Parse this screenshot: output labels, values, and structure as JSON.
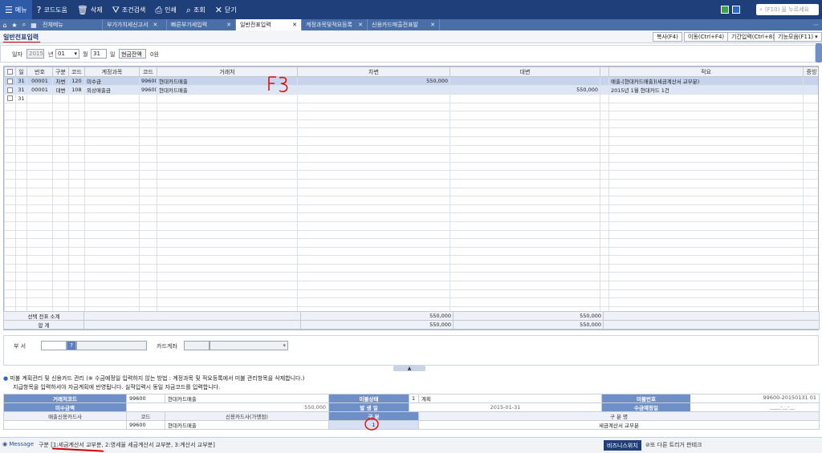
{
  "toolbar": {
    "items": [
      {
        "icon": "hamburger-icon",
        "glyph": "☰",
        "label": "메뉴"
      },
      {
        "icon": "help-icon",
        "glyph": "?",
        "label": "코드도움"
      },
      {
        "icon": "trash-icon",
        "glyph": "🗑",
        "label": "삭제"
      },
      {
        "icon": "filter-icon",
        "glyph": "⛛",
        "label": "조건검색"
      },
      {
        "icon": "print-icon",
        "glyph": "⎙",
        "label": "인쇄"
      },
      {
        "icon": "search-icon",
        "glyph": "⌕",
        "label": "조회"
      },
      {
        "icon": "close-icon",
        "glyph": "✕",
        "label": "닫기"
      }
    ],
    "search_placeholder": "(F10) 을 누르세요"
  },
  "tabs": [
    {
      "label": "전체메뉴",
      "closable": false,
      "active": false
    },
    {
      "label": "부가가치세신고서",
      "closable": true,
      "active": false
    },
    {
      "label": "빠른부가세입력",
      "closable": true,
      "active": false
    },
    {
      "label": "일반전표입력",
      "closable": true,
      "active": true
    },
    {
      "label": "계정과목및적요등록",
      "closable": true,
      "active": false
    },
    {
      "label": "신용카드매출전표발",
      "closable": true,
      "active": false
    }
  ],
  "page": {
    "title": "일반전표입력",
    "buttons": [
      "복사(F4)",
      "이동(Ctrl+F4)",
      "기간입력(Ctrl+8)",
      "기능모음(F11)"
    ]
  },
  "filter": {
    "date_label": "일자",
    "year": "2015",
    "year_suffix": "년",
    "month": "01",
    "month_suffix": "월",
    "day": "31",
    "day_suffix": "일",
    "cash_button": "현금잔액",
    "cash_value": "0원"
  },
  "grid": {
    "headers": [
      "일",
      "번호",
      "구분",
      "코드",
      "계정과목",
      "코드",
      "거래처",
      "차변",
      "대변",
      "적요",
      "증빙"
    ],
    "rows": [
      {
        "day": "31",
        "no": "00001",
        "type": "차변",
        "code": "120",
        "account": "미수금",
        "pcode": "99600",
        "partner": "현대카드매출",
        "debit": "550,000",
        "credit": "",
        "memo": "매출-[현대카드매출](세금계산서 교부분)",
        "evid": ""
      },
      {
        "day": "31",
        "no": "00001",
        "type": "대변",
        "code": "108",
        "account": "외상매출금",
        "pcode": "99600",
        "partner": "현대카드매출",
        "debit": "",
        "credit": "550,000",
        "memo": "2015년 1월 현대카드 1건",
        "evid": ""
      },
      {
        "day": "31",
        "no": "",
        "type": "",
        "code": "",
        "account": "",
        "pcode": "",
        "partner": "",
        "debit": "",
        "credit": "",
        "memo": "",
        "evid": ""
      }
    ],
    "subtotal_label": "선택 전표 소계",
    "subtotal_debit": "550,000",
    "subtotal_credit": "550,000",
    "total_label": "합 계",
    "total_debit": "550,000",
    "total_credit": "550,000"
  },
  "annotation": {
    "text": "F3",
    "color": "#e01010"
  },
  "dept": {
    "dept_label": "부 서",
    "dept_help": "?",
    "card_label": "카드계좌"
  },
  "bottom": {
    "note1": "미불 계획관리 및 신용카드 관리         (※ 수금예정일 입력하지 않는 방법 : 계정과목 및 적요등록에서 미불 관리항목을 삭제합니다.)",
    "note2": "지급항목을 입력하셔야 자금계획에 반영됩니다. 실적입력시 동일 자금코드를 입력합니다.",
    "row1": {
      "h1": "거래처코드",
      "v1a": "99600",
      "v1b": "현대카드매출",
      "h2": "미불상태",
      "v2a": "1",
      "v2b": "계획",
      "h3": "미불번호",
      "v3": "99600-20150131 01"
    },
    "row2": {
      "h1": "미수금액",
      "v1": "550,000",
      "h2": "발 생 일",
      "v2": "2015-01-31",
      "h3": "수금예정일",
      "v3": "____-__-__"
    },
    "row3": {
      "c1": "매출신용카드사",
      "c2": "코드",
      "c3": "신용카드사(가맹점)",
      "c4": "구 분",
      "c5": "구 분 명"
    },
    "row4": {
      "code": "99600",
      "name": "현대카드매출",
      "type": "1",
      "typename": "세금계산서 교부분"
    }
  },
  "status": {
    "message_label": "Message",
    "message_text": "구분 [1:세금계산서 교부분, 2:영세율 세금계산서 교부분, 3:계산서 교부분]",
    "biz_label": "비즈니스위치",
    "right_text": "⊘또 다른 트리거 판테크"
  }
}
